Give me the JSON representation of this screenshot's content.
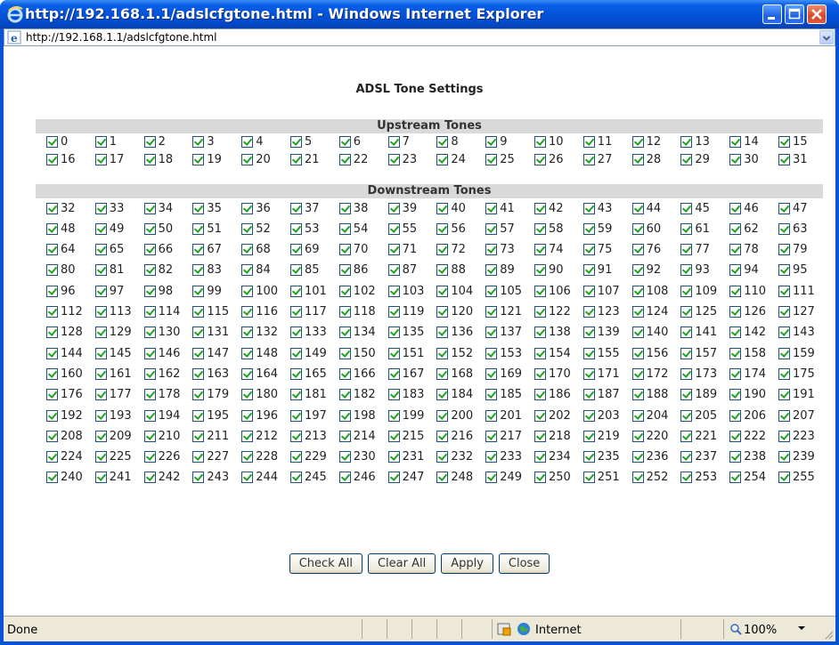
{
  "window": {
    "title": "http://192.168.1.1/adslcfgtone.html - Windows Internet Explorer",
    "icon": "ie-icon",
    "controls": [
      "minimize-icon",
      "maximize-icon",
      "close-icon"
    ]
  },
  "address_bar": {
    "url": "http://192.168.1.1/adslcfgtone.html",
    "icon": "ie-page-icon"
  },
  "page": {
    "title": "ADSL Tone Settings",
    "upstream_heading": "Upstream Tones",
    "downstream_heading": "Downstream Tones",
    "upstream_tones": {
      "from": 0,
      "to": 31,
      "checked": true
    },
    "downstream_tones": {
      "from": 32,
      "to": 255,
      "checked": true
    },
    "buttons": {
      "check_all": "Check All",
      "clear_all": "Clear All",
      "apply": "Apply",
      "close": "Close"
    }
  },
  "status_bar": {
    "status": "Done",
    "zone": "Internet",
    "zoom": "100%"
  },
  "colors": {
    "titlebar": "#0453d8",
    "checkmark": "#21a121",
    "band": "#d9d9d9"
  }
}
